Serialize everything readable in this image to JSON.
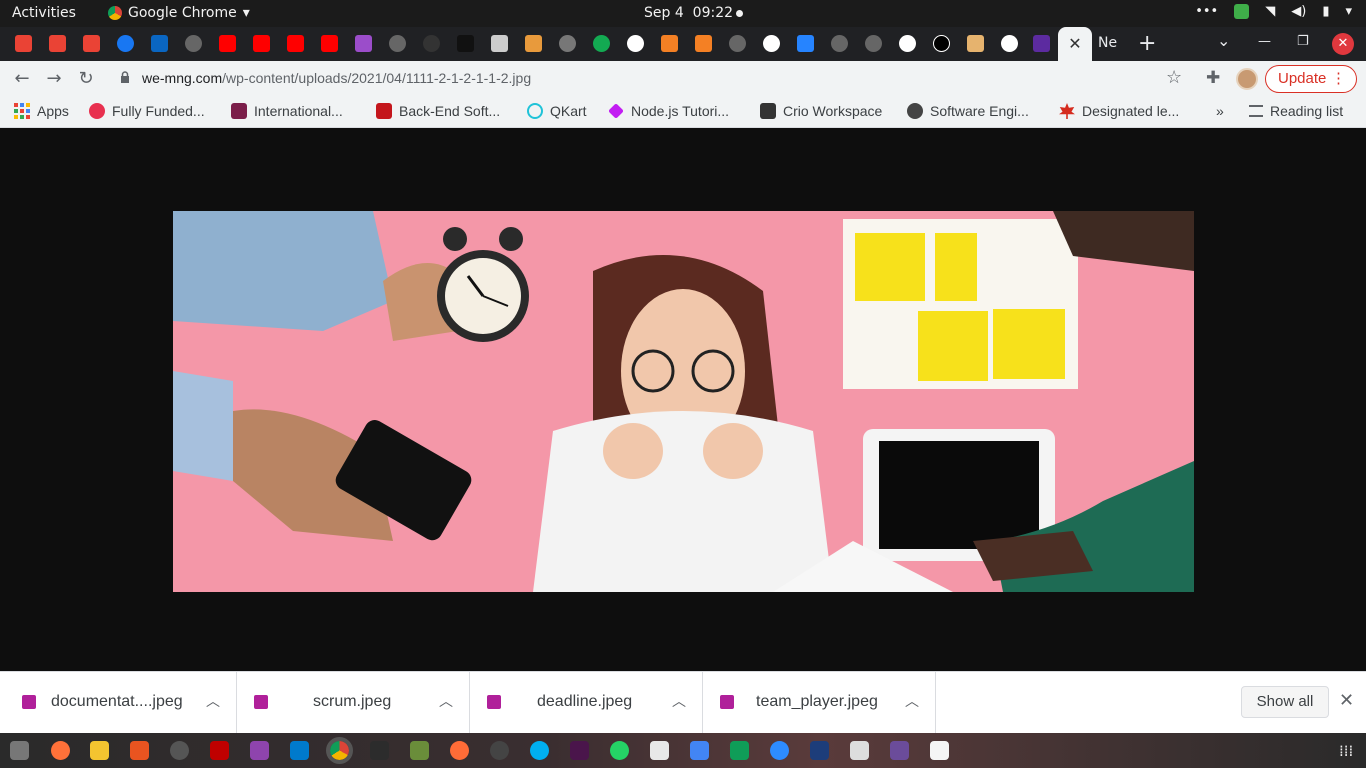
{
  "system_bar": {
    "activities": "Activities",
    "app_name": "Google Chrome",
    "date": "Sep 4",
    "time": "09:22"
  },
  "tabs": {
    "active_close": "✕",
    "partial_label": "Ne",
    "new_tab": "+"
  },
  "toolbar": {
    "url_domain": "we-mng.com",
    "url_path": "/wp-content/uploads/2021/04/1111-2-1-2-1-1-2.jpg",
    "update_label": "Update"
  },
  "bookmarks": [
    {
      "label": "Apps",
      "color": "#4285f4"
    },
    {
      "label": "Fully Funded...",
      "color": "#e8304f"
    },
    {
      "label": "International...",
      "color": "#7b1e4a"
    },
    {
      "label": "Back-End Soft...",
      "color": "#c4161c"
    },
    {
      "label": "QKart",
      "color": "#20c3d8"
    },
    {
      "label": "Node.js Tutori...",
      "color": "#c21df2"
    },
    {
      "label": "Crio Workspace",
      "color": "#333333"
    },
    {
      "label": "Software Engi...",
      "color": "#444444"
    },
    {
      "label": "Designated le...",
      "color": "#d52b1e"
    }
  ],
  "bookmarks_more": "»",
  "reading_list": "Reading list",
  "downloads": [
    {
      "name": "documentat....jpeg"
    },
    {
      "name": "scrum.jpeg"
    },
    {
      "name": "deadline.jpeg"
    },
    {
      "name": "team_player.jpeg"
    }
  ],
  "show_all_label": "Show all",
  "colors": {
    "accent_red": "#d93025",
    "photo_pink": "#f497a8"
  }
}
